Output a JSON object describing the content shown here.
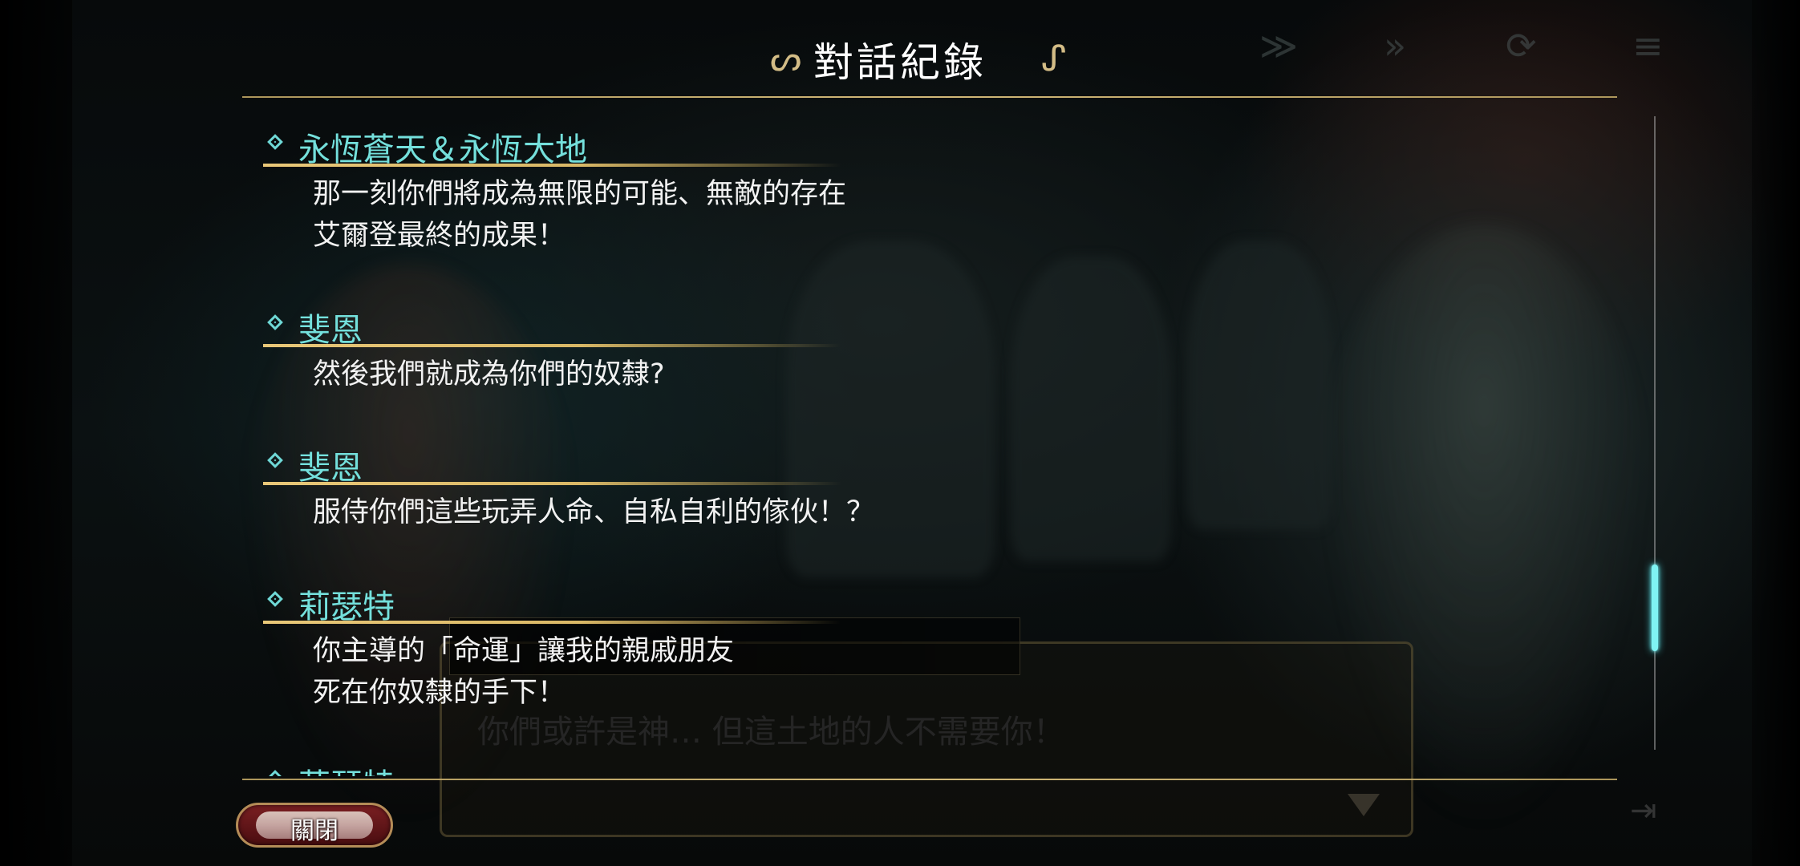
{
  "header": {
    "title": "對話紀錄",
    "ornament_left": "ᔕ",
    "ornament_right": "ᔑ"
  },
  "background": {
    "dialog_text": "你們或許是神… 但這土地的人不需要你！",
    "controls": [
      "≫",
      "»",
      "⟳",
      "≡"
    ],
    "skip_glyph": "⇥"
  },
  "log": {
    "entries": [
      {
        "speaker": "永恆蒼天＆永恆大地",
        "lines": [
          "那一刻你們將成為無限的可能、無敵的存在",
          "艾爾登最終的成果！"
        ]
      },
      {
        "speaker": "斐恩",
        "lines": [
          "然後我們就成為你們的奴隸?"
        ]
      },
      {
        "speaker": "斐恩",
        "lines": [
          "服侍你們這些玩弄人命、自私自利的傢伙！？"
        ]
      },
      {
        "speaker": "莉瑟特",
        "lines": [
          "你主導的「命運」讓我的親戚朋友",
          "死在你奴隸的手下！"
        ]
      },
      {
        "speaker": "莉瑟特",
        "lines": []
      }
    ]
  },
  "scrollbar": {
    "position_fraction": 0.82
  },
  "footer": {
    "close_label": "關閉"
  },
  "colors": {
    "speaker": "#74e0dc",
    "rule": "#d2b678",
    "scroll_thumb": "#7ff3f3",
    "close_button": "#7a1f22"
  }
}
